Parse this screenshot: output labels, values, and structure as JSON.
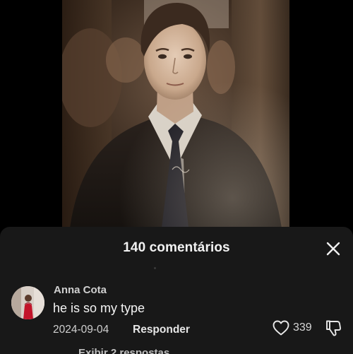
{
  "video": {
    "description_icon": "video-still"
  },
  "comments_panel": {
    "title": "140 comentários",
    "close_icon": "close-icon",
    "comments": [
      {
        "author": "Anna Cota",
        "text": "he is so my type",
        "date": "2024-09-04",
        "reply_label": "Responder",
        "like_count": "339",
        "like_icon": "heart-outline-icon",
        "dislike_icon": "thumbs-down-icon"
      }
    ],
    "next_comment_peek": "Exibir 2 respostas"
  },
  "colors": {
    "sheet_background": "#181818",
    "page_background": "#000000",
    "primary_text": "#f4f4f4",
    "secondary_text": "#cfcfcf"
  }
}
